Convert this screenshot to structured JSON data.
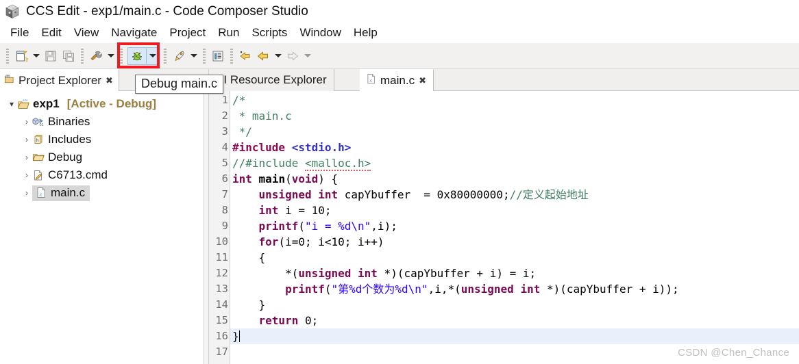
{
  "window": {
    "title": "CCS Edit - exp1/main.c - Code Composer Studio",
    "app_icon": "ccs-cube-icon"
  },
  "menubar": {
    "items": [
      {
        "label": "File"
      },
      {
        "label": "Edit"
      },
      {
        "label": "View"
      },
      {
        "label": "Navigate"
      },
      {
        "label": "Project"
      },
      {
        "label": "Run"
      },
      {
        "label": "Scripts"
      },
      {
        "label": "Window"
      },
      {
        "label": "Help"
      }
    ]
  },
  "toolbar": {
    "new_label": "New",
    "save_label": "Save",
    "save_all_label": "Save All",
    "build_label": "Build",
    "debug_label": "Debug",
    "run_label": "Run",
    "outline_label": "Toggle Mark Occurrences",
    "back_to_label": "Back To",
    "back_label": "Back",
    "forward_label": "Forward",
    "highlight_color": "#ee1b24",
    "debug_group_bg": "#d9e8f6"
  },
  "tooltip": {
    "text": "Debug main.c"
  },
  "project_explorer": {
    "tab_label": "Project Explorer",
    "tab_icon": "project-explorer-icon",
    "close_glyph": "✖",
    "tree": [
      {
        "label": "exp1",
        "suffix": "[Active - Debug]",
        "icon": "ccs-project-folder-icon",
        "twisty": "▾",
        "level": 0,
        "bold": true,
        "selected": false
      },
      {
        "label": "Binaries",
        "suffix": "",
        "icon": "binaries-icon",
        "twisty": "›",
        "level": 1,
        "bold": false,
        "selected": false
      },
      {
        "label": "Includes",
        "suffix": "",
        "icon": "includes-icon",
        "twisty": "›",
        "level": 1,
        "bold": false,
        "selected": false
      },
      {
        "label": "Debug",
        "suffix": "",
        "icon": "folder-icon",
        "twisty": "›",
        "level": 1,
        "bold": false,
        "selected": false
      },
      {
        "label": "C6713.cmd",
        "suffix": "",
        "icon": "cmd-file-icon",
        "twisty": "›",
        "level": 1,
        "bold": false,
        "selected": false
      },
      {
        "label": "main.c",
        "suffix": "",
        "icon": "c-file-icon",
        "twisty": "›",
        "level": 1,
        "bold": false,
        "selected": true
      }
    ]
  },
  "editor": {
    "tabs": [
      {
        "label": "TI Resource Explorer",
        "icon": "",
        "active": false,
        "closable": false
      },
      {
        "label": "main.c",
        "icon": "c-file-icon",
        "active": true,
        "closable": true
      }
    ],
    "close_glyph": "✖",
    "cursor_line": 16,
    "line_numbers": [
      1,
      2,
      3,
      4,
      5,
      6,
      7,
      8,
      9,
      10,
      11,
      12,
      13,
      14,
      15,
      16,
      17
    ],
    "lines": [
      {
        "n": 1,
        "text": "/*"
      },
      {
        "n": 2,
        "text": " * main.c"
      },
      {
        "n": 3,
        "text": " */"
      },
      {
        "n": 4,
        "text": "#include <stdio.h>"
      },
      {
        "n": 5,
        "text": "//#include <malloc.h>"
      },
      {
        "n": 6,
        "text": "int main(void) {"
      },
      {
        "n": 7,
        "text": "    unsigned int capYbuffer  = 0x80000000;//定义起始地址"
      },
      {
        "n": 8,
        "text": "    int i = 10;"
      },
      {
        "n": 9,
        "text": "    printf(\"i = %d\\n\",i);"
      },
      {
        "n": 10,
        "text": "    for(i=0; i<10; i++)"
      },
      {
        "n": 11,
        "text": "    {"
      },
      {
        "n": 12,
        "text": "        *(unsigned int *)(capYbuffer + i) = i;"
      },
      {
        "n": 13,
        "text": "        printf(\"第%d个数为%d\\n\",i,*(unsigned int *)(capYbuffer + i));"
      },
      {
        "n": 14,
        "text": "    }"
      },
      {
        "n": 15,
        "text": "    return 0;"
      },
      {
        "n": 16,
        "text": "}"
      },
      {
        "n": 17,
        "text": ""
      }
    ]
  },
  "watermark": {
    "text": "CSDN @Chen_Chance"
  },
  "colors": {
    "keyword": "#7a0a52",
    "preprocessor": "#8b0a50",
    "header": "#3232c8",
    "comment": "#3f7f5f",
    "string": "#2a00ff",
    "plain": "#000000",
    "gutter_text": "#6e6e6e",
    "cursor_line_bg": "#e8f1fb",
    "active_project": "#9a7e3c"
  }
}
